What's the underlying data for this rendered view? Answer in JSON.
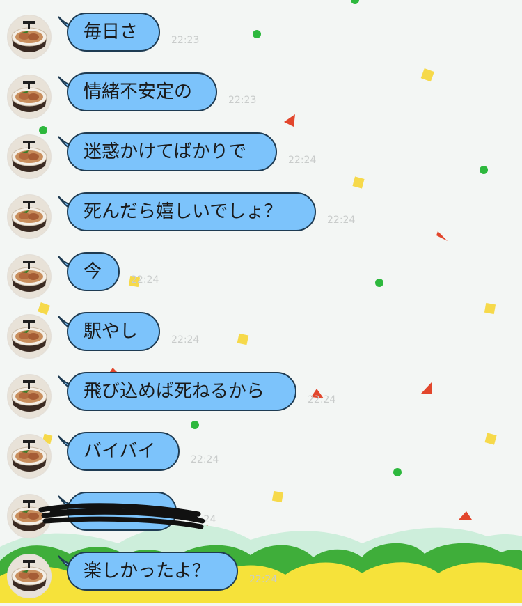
{
  "messages": [
    {
      "text": "毎日さ",
      "time": "22:23"
    },
    {
      "text": "情緒不安定の",
      "time": "22:23"
    },
    {
      "text": "迷惑かけてばかりで",
      "time": "22:24"
    },
    {
      "text": "死んだら嬉しいでしょ？",
      "time": "22:24"
    },
    {
      "text": "今",
      "time": "22:24"
    },
    {
      "text": "駅やし",
      "time": "22:24"
    },
    {
      "text": "飛び込めば死ねるから",
      "time": "22:24"
    },
    {
      "text": "バイバイ",
      "time": "22:24"
    },
    {
      "text": "",
      "time": "22:24"
    },
    {
      "text": "楽しかったよ？",
      "time": "22:24"
    }
  ],
  "colors": {
    "bubble": "#7cc3fb",
    "bubble_border": "#1e3b52",
    "background": "#f3f6f4",
    "confetti_green": "#2db83d",
    "confetti_yellow": "#f6d94a",
    "confetti_red": "#e2462c",
    "ground_green": "#3fae3a",
    "ground_yellow": "#f6e23a"
  },
  "icons": {
    "avatar": "ramen-bowl-avatar",
    "redaction": "black-scribble-redaction"
  }
}
